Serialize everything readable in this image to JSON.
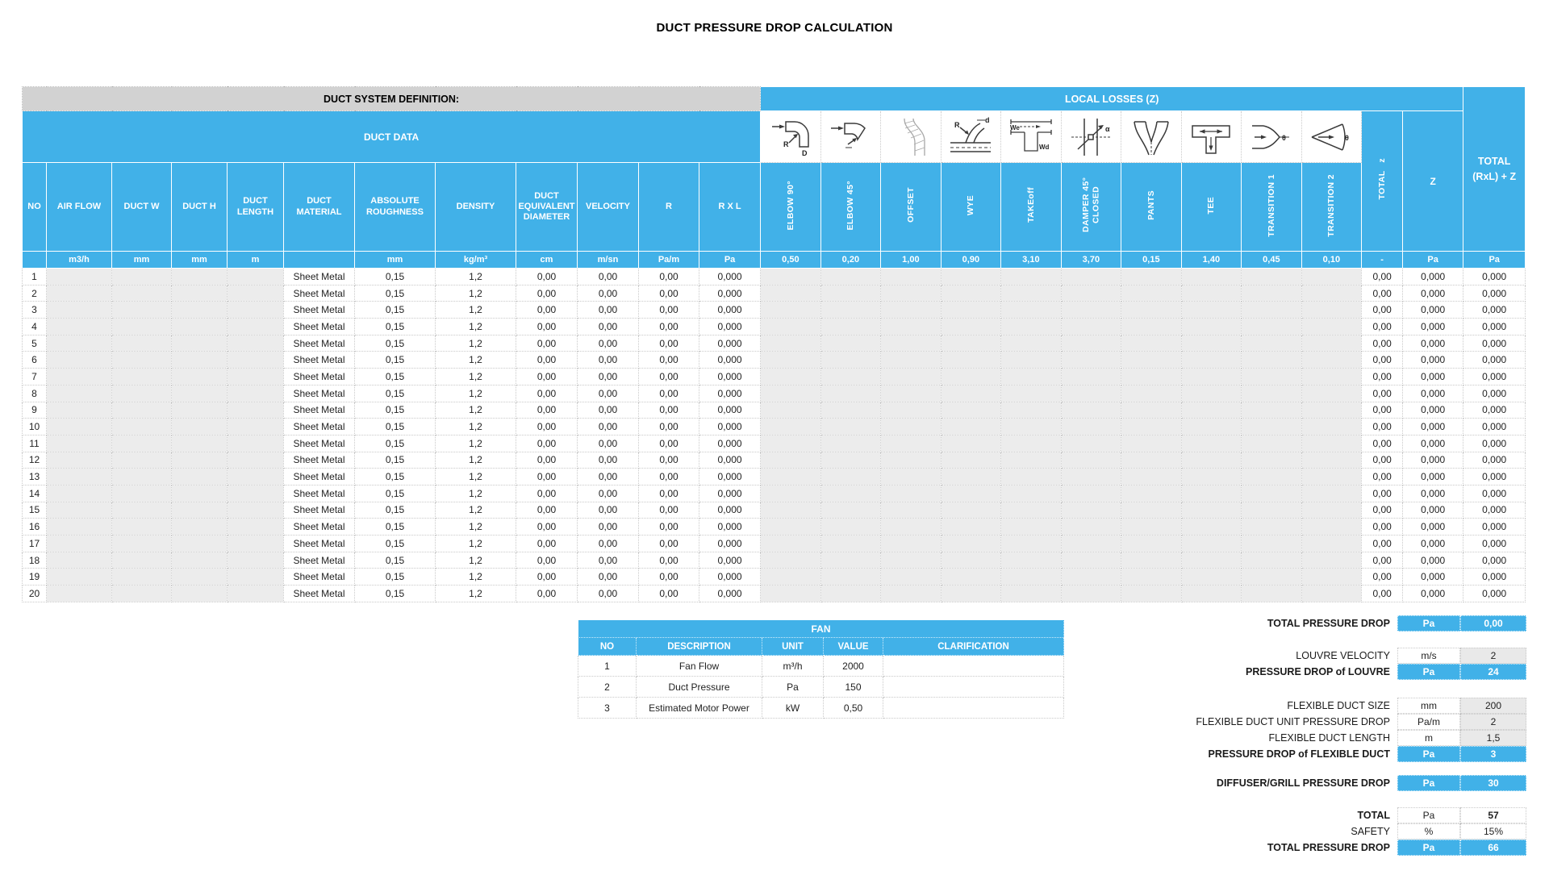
{
  "title": "DUCT PRESSURE DROP CALCULATION",
  "colors": {
    "accent_blue": "#41B1E8",
    "band_gray": "#D2D2D2",
    "input_gray": "#ECECEC"
  },
  "main_table": {
    "section_left": "DUCT SYSTEM DEFINITION:",
    "section_right": "LOCAL LOSSES (Z)",
    "duct_data_header": "DUCT DATA",
    "total_header_line1": "TOTAL",
    "total_header_line2": "(RxL) + Z",
    "duct_columns": [
      {
        "label": "NO",
        "unit": ""
      },
      {
        "label": "AIR FLOW",
        "unit": "m3/h"
      },
      {
        "label": "DUCT W",
        "unit": "mm"
      },
      {
        "label": "DUCT H",
        "unit": "mm"
      },
      {
        "label": "DUCT LENGTH",
        "unit": "m"
      },
      {
        "label": "DUCT MATERIAL",
        "unit": ""
      },
      {
        "label": "ABSOLUTE ROUGHNESS",
        "unit": "mm"
      },
      {
        "label": "DENSITY",
        "unit": "kg/m³"
      },
      {
        "label": "DUCT EQUIVALENT DIAMETER",
        "unit": "cm"
      },
      {
        "label": "VELOCITY",
        "unit": "m/sn"
      },
      {
        "label": "R",
        "unit": "Pa/m"
      },
      {
        "label": "R X L",
        "unit": "Pa"
      }
    ],
    "loss_columns": [
      {
        "label": "ELBOW 90°",
        "coeff": "0,50",
        "icon": "elbow-90-icon"
      },
      {
        "label": "ELBOW 45°",
        "coeff": "0,20",
        "icon": "elbow-45-icon"
      },
      {
        "label": "OFFSET",
        "coeff": "1,00",
        "icon": "offset-icon"
      },
      {
        "label": "WYE",
        "coeff": "0,90",
        "icon": "wye-icon"
      },
      {
        "label": "TAKEoff",
        "coeff": "3,10",
        "icon": "takeoff-icon"
      },
      {
        "label": "DAMPER 45° CLOSED",
        "coeff": "3,70",
        "icon": "damper-45-closed-icon"
      },
      {
        "label": "PANTS",
        "coeff": "0,15",
        "icon": "pants-icon"
      },
      {
        "label": "TEE",
        "coeff": "1,40",
        "icon": "tee-icon"
      },
      {
        "label": "TRANSITION 1",
        "coeff": "0,45",
        "icon": "transition-1-icon"
      },
      {
        "label": "TRANSITION 2",
        "coeff": "0,10",
        "icon": "transition-2-icon"
      }
    ],
    "total_z_column": {
      "label": "TOTAL   z",
      "unit": "-"
    },
    "z_column": {
      "label": "Z",
      "unit": "Pa"
    },
    "total_column": {
      "unit": "Pa"
    },
    "rows": [
      {
        "no": "1",
        "duct_material": "Sheet Metal",
        "absolute_roughness": "0,15",
        "density": "1,2",
        "duct_equivalent_diameter": "0,00",
        "velocity": "0,00",
        "r": "0,00",
        "r_x_l": "0,000",
        "total_z": "0,00",
        "z": "0,000",
        "total": "0,000"
      },
      {
        "no": "2",
        "duct_material": "Sheet Metal",
        "absolute_roughness": "0,15",
        "density": "1,2",
        "duct_equivalent_diameter": "0,00",
        "velocity": "0,00",
        "r": "0,00",
        "r_x_l": "0,000",
        "total_z": "0,00",
        "z": "0,000",
        "total": "0,000"
      },
      {
        "no": "3",
        "duct_material": "Sheet Metal",
        "absolute_roughness": "0,15",
        "density": "1,2",
        "duct_equivalent_diameter": "0,00",
        "velocity": "0,00",
        "r": "0,00",
        "r_x_l": "0,000",
        "total_z": "0,00",
        "z": "0,000",
        "total": "0,000"
      },
      {
        "no": "4",
        "duct_material": "Sheet Metal",
        "absolute_roughness": "0,15",
        "density": "1,2",
        "duct_equivalent_diameter": "0,00",
        "velocity": "0,00",
        "r": "0,00",
        "r_x_l": "0,000",
        "total_z": "0,00",
        "z": "0,000",
        "total": "0,000"
      },
      {
        "no": "5",
        "duct_material": "Sheet Metal",
        "absolute_roughness": "0,15",
        "density": "1,2",
        "duct_equivalent_diameter": "0,00",
        "velocity": "0,00",
        "r": "0,00",
        "r_x_l": "0,000",
        "total_z": "0,00",
        "z": "0,000",
        "total": "0,000"
      },
      {
        "no": "6",
        "duct_material": "Sheet Metal",
        "absolute_roughness": "0,15",
        "density": "1,2",
        "duct_equivalent_diameter": "0,00",
        "velocity": "0,00",
        "r": "0,00",
        "r_x_l": "0,000",
        "total_z": "0,00",
        "z": "0,000",
        "total": "0,000"
      },
      {
        "no": "7",
        "duct_material": "Sheet Metal",
        "absolute_roughness": "0,15",
        "density": "1,2",
        "duct_equivalent_diameter": "0,00",
        "velocity": "0,00",
        "r": "0,00",
        "r_x_l": "0,000",
        "total_z": "0,00",
        "z": "0,000",
        "total": "0,000"
      },
      {
        "no": "8",
        "duct_material": "Sheet Metal",
        "absolute_roughness": "0,15",
        "density": "1,2",
        "duct_equivalent_diameter": "0,00",
        "velocity": "0,00",
        "r": "0,00",
        "r_x_l": "0,000",
        "total_z": "0,00",
        "z": "0,000",
        "total": "0,000"
      },
      {
        "no": "9",
        "duct_material": "Sheet Metal",
        "absolute_roughness": "0,15",
        "density": "1,2",
        "duct_equivalent_diameter": "0,00",
        "velocity": "0,00",
        "r": "0,00",
        "r_x_l": "0,000",
        "total_z": "0,00",
        "z": "0,000",
        "total": "0,000"
      },
      {
        "no": "10",
        "duct_material": "Sheet Metal",
        "absolute_roughness": "0,15",
        "density": "1,2",
        "duct_equivalent_diameter": "0,00",
        "velocity": "0,00",
        "r": "0,00",
        "r_x_l": "0,000",
        "total_z": "0,00",
        "z": "0,000",
        "total": "0,000"
      },
      {
        "no": "11",
        "duct_material": "Sheet Metal",
        "absolute_roughness": "0,15",
        "density": "1,2",
        "duct_equivalent_diameter": "0,00",
        "velocity": "0,00",
        "r": "0,00",
        "r_x_l": "0,000",
        "total_z": "0,00",
        "z": "0,000",
        "total": "0,000"
      },
      {
        "no": "12",
        "duct_material": "Sheet Metal",
        "absolute_roughness": "0,15",
        "density": "1,2",
        "duct_equivalent_diameter": "0,00",
        "velocity": "0,00",
        "r": "0,00",
        "r_x_l": "0,000",
        "total_z": "0,00",
        "z": "0,000",
        "total": "0,000"
      },
      {
        "no": "13",
        "duct_material": "Sheet Metal",
        "absolute_roughness": "0,15",
        "density": "1,2",
        "duct_equivalent_diameter": "0,00",
        "velocity": "0,00",
        "r": "0,00",
        "r_x_l": "0,000",
        "total_z": "0,00",
        "z": "0,000",
        "total": "0,000"
      },
      {
        "no": "14",
        "duct_material": "Sheet Metal",
        "absolute_roughness": "0,15",
        "density": "1,2",
        "duct_equivalent_diameter": "0,00",
        "velocity": "0,00",
        "r": "0,00",
        "r_x_l": "0,000",
        "total_z": "0,00",
        "z": "0,000",
        "total": "0,000"
      },
      {
        "no": "15",
        "duct_material": "Sheet Metal",
        "absolute_roughness": "0,15",
        "density": "1,2",
        "duct_equivalent_diameter": "0,00",
        "velocity": "0,00",
        "r": "0,00",
        "r_x_l": "0,000",
        "total_z": "0,00",
        "z": "0,000",
        "total": "0,000"
      },
      {
        "no": "16",
        "duct_material": "Sheet Metal",
        "absolute_roughness": "0,15",
        "density": "1,2",
        "duct_equivalent_diameter": "0,00",
        "velocity": "0,00",
        "r": "0,00",
        "r_x_l": "0,000",
        "total_z": "0,00",
        "z": "0,000",
        "total": "0,000"
      },
      {
        "no": "17",
        "duct_material": "Sheet Metal",
        "absolute_roughness": "0,15",
        "density": "1,2",
        "duct_equivalent_diameter": "0,00",
        "velocity": "0,00",
        "r": "0,00",
        "r_x_l": "0,000",
        "total_z": "0,00",
        "z": "0,000",
        "total": "0,000"
      },
      {
        "no": "18",
        "duct_material": "Sheet Metal",
        "absolute_roughness": "0,15",
        "density": "1,2",
        "duct_equivalent_diameter": "0,00",
        "velocity": "0,00",
        "r": "0,00",
        "r_x_l": "0,000",
        "total_z": "0,00",
        "z": "0,000",
        "total": "0,000"
      },
      {
        "no": "19",
        "duct_material": "Sheet Metal",
        "absolute_roughness": "0,15",
        "density": "1,2",
        "duct_equivalent_diameter": "0,00",
        "velocity": "0,00",
        "r": "0,00",
        "r_x_l": "0,000",
        "total_z": "0,00",
        "z": "0,000",
        "total": "0,000"
      },
      {
        "no": "20",
        "duct_material": "Sheet Metal",
        "absolute_roughness": "0,15",
        "density": "1,2",
        "duct_equivalent_diameter": "0,00",
        "velocity": "0,00",
        "r": "0,00",
        "r_x_l": "0,000",
        "total_z": "0,00",
        "z": "0,000",
        "total": "0,000"
      }
    ]
  },
  "fan_table": {
    "title": "FAN",
    "columns": [
      "NO",
      "DESCRIPTION",
      "UNIT",
      "VALUE",
      "CLARIFICATION"
    ],
    "rows": [
      {
        "no": "1",
        "description": "Fan Flow",
        "unit": "m³/h",
        "value": "2000",
        "clarification": ""
      },
      {
        "no": "2",
        "description": "Duct Pressure",
        "unit": "Pa",
        "value": "150",
        "clarification": ""
      },
      {
        "no": "3",
        "description": "Estimated Motor Power",
        "unit": "kW",
        "value": "0,50",
        "clarification": ""
      }
    ]
  },
  "summary": {
    "rows": [
      {
        "label": "TOTAL PRESSURE DROP",
        "unit": "Pa",
        "value": "0,00",
        "highlight": true,
        "bold_label": true,
        "bold_value": false,
        "value_input": false,
        "gap_before": 0
      },
      {
        "label": "LOUVRE VELOCITY",
        "unit": "m/s",
        "value": "2",
        "highlight": false,
        "bold_label": false,
        "bold_value": false,
        "value_input": true,
        "gap_before": 20
      },
      {
        "label": "PRESSURE DROP of LOUVRE",
        "unit": "Pa",
        "value": "24",
        "highlight": true,
        "bold_label": true,
        "bold_value": false,
        "value_input": false,
        "gap_before": 0
      },
      {
        "label": "FLEXIBLE DUCT SIZE",
        "unit": "mm",
        "value": "200",
        "highlight": false,
        "bold_label": false,
        "bold_value": false,
        "value_input": true,
        "gap_before": 22
      },
      {
        "label": "FLEXIBLE DUCT UNIT PRESSURE DROP",
        "unit": "Pa/m",
        "value": "2",
        "highlight": false,
        "bold_label": false,
        "bold_value": false,
        "value_input": true,
        "gap_before": 0
      },
      {
        "label": "FLEXIBLE DUCT LENGTH",
        "unit": "m",
        "value": "1,5",
        "highlight": false,
        "bold_label": false,
        "bold_value": false,
        "value_input": true,
        "gap_before": 0
      },
      {
        "label": "PRESSURE DROP of FLEXIBLE DUCT",
        "unit": "Pa",
        "value": "3",
        "highlight": true,
        "bold_label": true,
        "bold_value": false,
        "value_input": false,
        "gap_before": 0
      },
      {
        "label": "DIFFUSER/GRILL PRESSURE DROP",
        "unit": "Pa",
        "value": "30",
        "highlight": true,
        "bold_label": true,
        "bold_value": false,
        "value_input": false,
        "gap_before": 16
      },
      {
        "label": "TOTAL",
        "unit": "Pa",
        "value": "57",
        "highlight": false,
        "bold_label": true,
        "bold_value": true,
        "value_input": false,
        "gap_before": 20
      },
      {
        "label": "SAFETY",
        "unit": "%",
        "value": "15%",
        "highlight": false,
        "bold_label": false,
        "bold_value": false,
        "value_input": false,
        "gap_before": 0
      },
      {
        "label": "TOTAL PRESSURE DROP",
        "unit": "Pa",
        "value": "66",
        "highlight": true,
        "bold_label": true,
        "bold_value": false,
        "value_input": false,
        "gap_before": 0
      }
    ]
  }
}
